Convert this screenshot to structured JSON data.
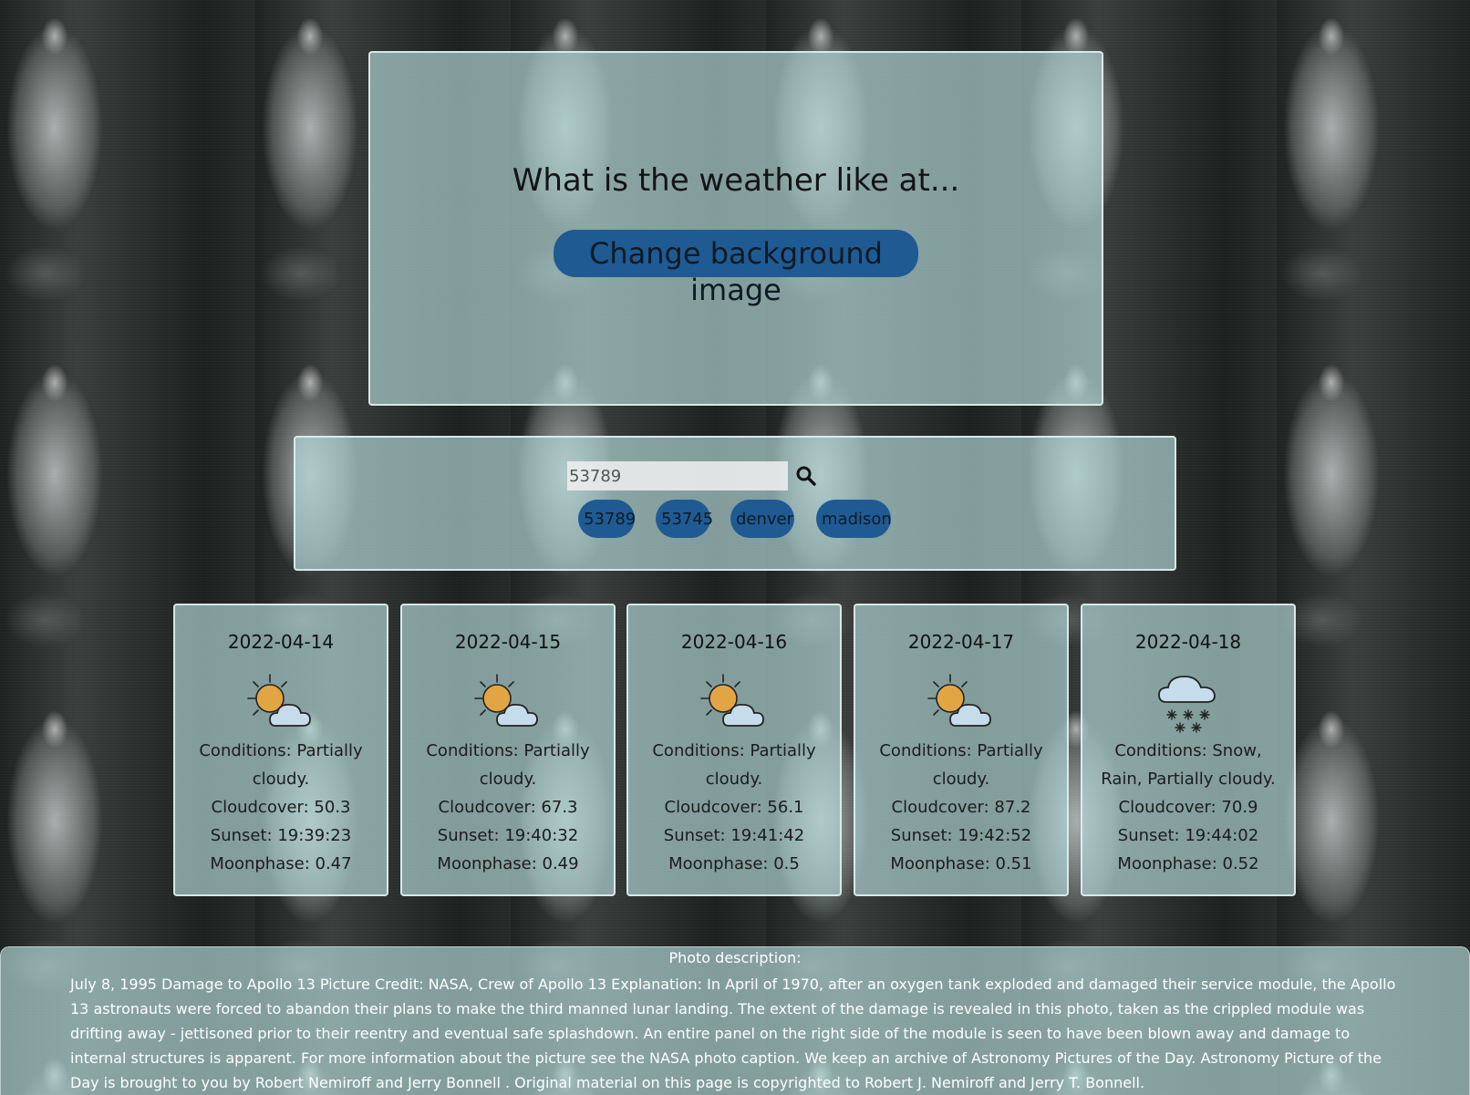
{
  "hero": {
    "heading": "What is the weather like at...",
    "bg_button_label": "Change background image"
  },
  "search": {
    "input_value": "53789",
    "search_icon": "search-icon",
    "history": [
      "53789",
      "53745",
      "denver",
      "madison"
    ]
  },
  "forecast": [
    {
      "date": "2022-04-14",
      "icon": "partly-cloudy-day-icon",
      "conditions": "Conditions: Partially cloudy.",
      "cloudcover": "Cloudcover: 50.3",
      "sunset": "Sunset: 19:39:23",
      "moonphase": "Moonphase: 0.47"
    },
    {
      "date": "2022-04-15",
      "icon": "partly-cloudy-day-icon",
      "conditions": "Conditions: Partially cloudy.",
      "cloudcover": "Cloudcover: 67.3",
      "sunset": "Sunset: 19:40:32",
      "moonphase": "Moonphase: 0.49"
    },
    {
      "date": "2022-04-16",
      "icon": "partly-cloudy-day-icon",
      "conditions": "Conditions: Partially cloudy.",
      "cloudcover": "Cloudcover: 56.1",
      "sunset": "Sunset: 19:41:42",
      "moonphase": "Moonphase: 0.5"
    },
    {
      "date": "2022-04-17",
      "icon": "partly-cloudy-day-icon",
      "conditions": "Conditions: Partially cloudy.",
      "cloudcover": "Cloudcover: 87.2",
      "sunset": "Sunset: 19:42:52",
      "moonphase": "Moonphase: 0.51"
    },
    {
      "date": "2022-04-18",
      "icon": "snow-icon",
      "conditions": "Conditions: Snow, Rain, Partially cloudy.",
      "cloudcover": "Cloudcover: 70.9",
      "sunset": "Sunset: 19:44:02",
      "moonphase": "Moonphase: 0.52"
    }
  ],
  "photo": {
    "title": "Photo description:",
    "text": "July 8, 1995 Damage to Apollo 13 Picture Credit: NASA, Crew of Apollo 13 Explanation: In April of 1970, after an oxygen tank exploded and damaged their service module, the Apollo 13 astronauts were forced to abandon their plans to make the third manned lunar landing. The extent of the damage is revealed in this photo, taken as the crippled module was drifting away - jettisoned prior to their reentry and eventual safe splashdown. An entire panel on the right side of the module is seen to have been blown away and damage to internal structures is apparent. For more information about the picture see the NASA photo caption. We keep an archive of Astronomy Pictures of the Day. Astronomy Picture of the Day is brought to you by Robert Nemiroff and Jerry Bonnell . Original material on this page is copyrighted to Robert J. Nemiroff and Jerry T. Bonnell."
  },
  "colors": {
    "panel": "#b2d7d7",
    "button": "#1f5b92"
  }
}
